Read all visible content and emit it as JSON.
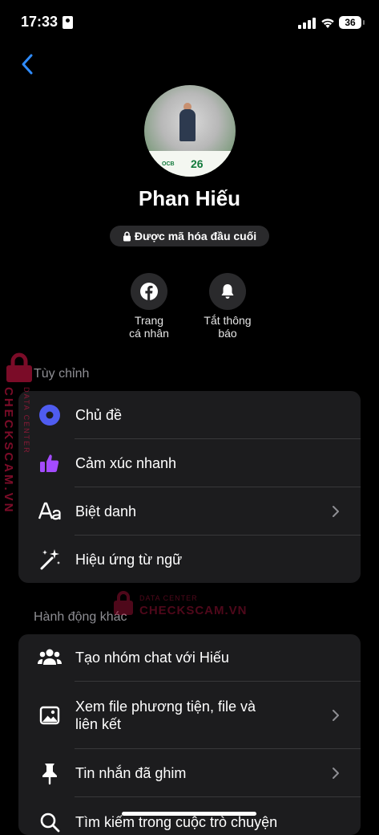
{
  "status": {
    "time": "17:33",
    "battery": "36"
  },
  "profile": {
    "name": "Phan Hiếu",
    "encryption": "Được mã hóa đầu cuối"
  },
  "actions": [
    {
      "label_line1": "Trang",
      "label_line2": "cá nhân"
    },
    {
      "label_line1": "Tắt thông",
      "label_line2": "báo"
    }
  ],
  "sections": {
    "customize_title": "Tùy chỉnh",
    "other_title": "Hành động khác"
  },
  "customize_items": [
    {
      "label": "Chủ đề",
      "icon": "theme-circle-icon"
    },
    {
      "label": "Cảm xúc nhanh",
      "icon": "thumbs-up-icon"
    },
    {
      "label": "Biệt danh",
      "icon": "aa-text-icon"
    },
    {
      "label": "Hiệu ứng từ ngữ",
      "icon": "magic-wand-icon"
    }
  ],
  "other_items": [
    {
      "label": "Tạo nhóm chat với Hiếu",
      "icon": "group-icon"
    },
    {
      "label_line1": "Xem file phương tiện, file và",
      "label_line2": "liên kết",
      "icon": "image-icon"
    },
    {
      "label": "Tin nhắn đã ghim",
      "icon": "pin-icon"
    },
    {
      "label": "Tìm kiếm trong cuộc trò chuyện",
      "icon": "search-icon"
    }
  ],
  "avatar": {
    "logo_text": "OCB",
    "badge_text": "26"
  },
  "watermark": {
    "brand": "CHECKSCAM.VN",
    "sub": "DATA CENTER"
  },
  "colors": {
    "theme_blue": "#4f5cf0",
    "accent_purple": "#a34bff",
    "back_blue": "#2f8cff"
  }
}
